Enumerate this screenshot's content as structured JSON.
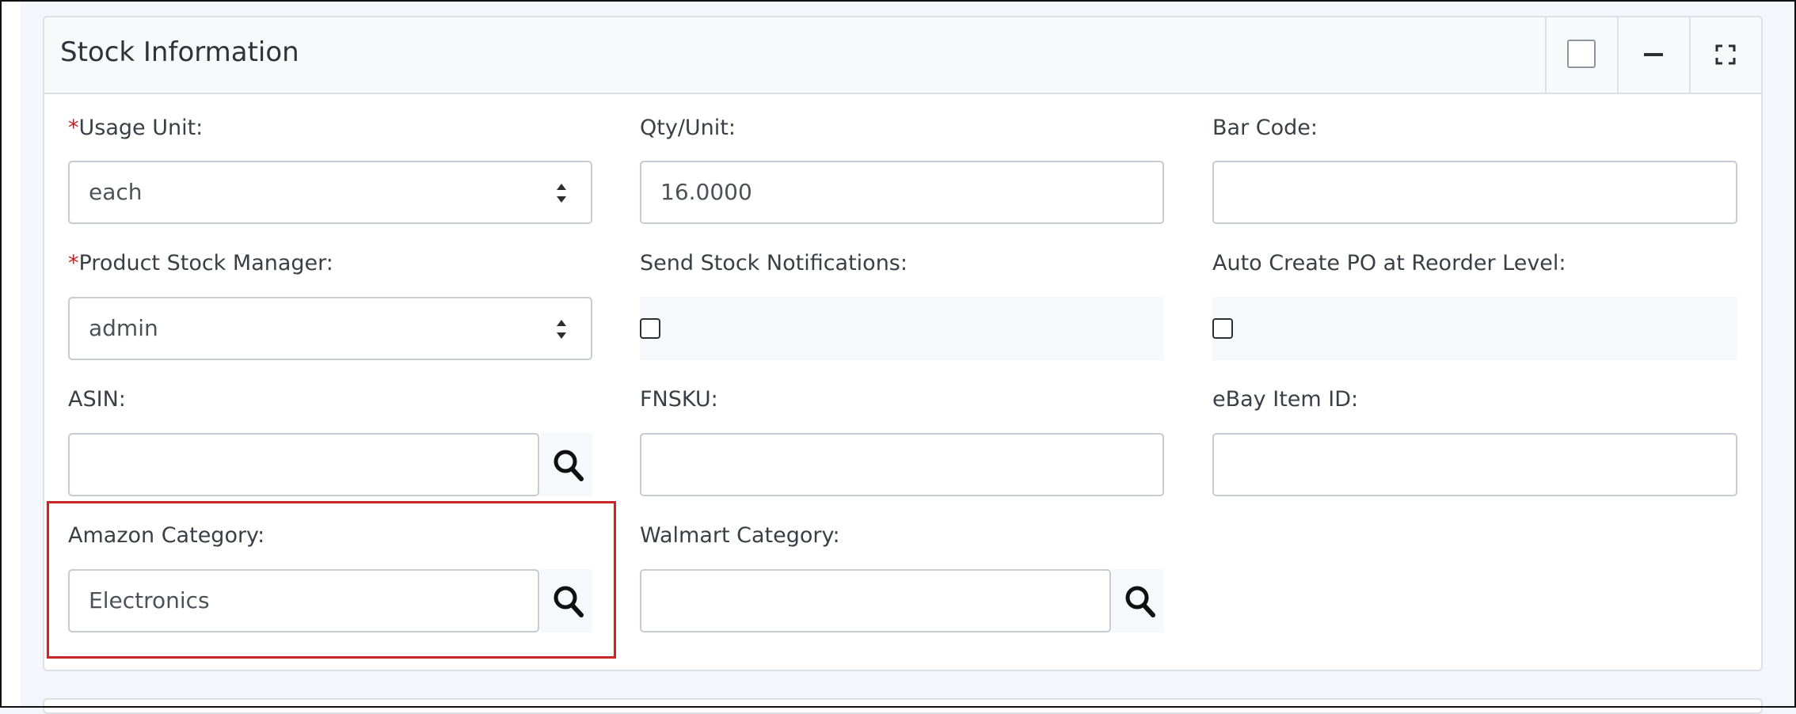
{
  "panel": {
    "title": "Stock Information",
    "controls": [
      {
        "icon": "checkbox-outline-icon"
      },
      {
        "icon": "minimize-icon"
      },
      {
        "icon": "fullscreen-icon"
      }
    ]
  },
  "fields": {
    "usage_unit": {
      "required_mark": "*",
      "label": "Usage Unit:",
      "value": "each",
      "control": "select"
    },
    "qty_unit": {
      "label": "Qty/Unit:",
      "value": "16.0000"
    },
    "bar_code": {
      "label": "Bar Code:",
      "value": ""
    },
    "stock_manager": {
      "required_mark": "*",
      "label": "Product Stock Manager:",
      "value": "admin",
      "control": "select"
    },
    "send_notifications": {
      "label": "Send Stock Notifications:",
      "checked": false
    },
    "auto_po": {
      "label": "Auto Create PO at Reorder Level:",
      "checked": false
    },
    "asin": {
      "label": "ASIN:",
      "value": "",
      "search_icon": "search-icon"
    },
    "fnsku": {
      "label": "FNSKU:",
      "value": ""
    },
    "ebay_id": {
      "label": "eBay Item ID:",
      "value": ""
    },
    "amazon_category": {
      "label": "Amazon Category:",
      "value": "Electronics",
      "search_icon": "search-icon",
      "highlighted": true
    },
    "walmart_category": {
      "label": "Walmart Category:",
      "value": "",
      "search_icon": "search-icon"
    }
  },
  "colors": {
    "required": "#cc1f1f",
    "highlight_border": "#c62828",
    "panel_header_bg": "#f8f9fa",
    "page_bg": "#f4f6fb"
  }
}
